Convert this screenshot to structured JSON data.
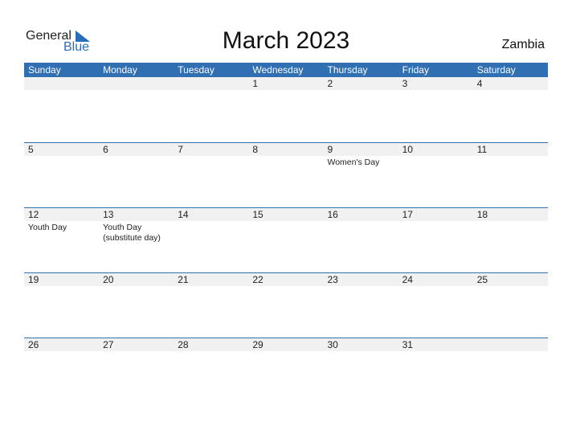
{
  "logo": {
    "general": "General",
    "blue": "Blue"
  },
  "title": "March 2023",
  "country": "Zambia",
  "colors": {
    "accent": "#2f6fb2",
    "row_bg": "#f1f1f1"
  },
  "weekdays": [
    "Sunday",
    "Monday",
    "Tuesday",
    "Wednesday",
    "Thursday",
    "Friday",
    "Saturday"
  ],
  "weeks": [
    {
      "days": [
        "",
        "",
        "",
        "1",
        "2",
        "3",
        "4"
      ],
      "events": [
        "",
        "",
        "",
        "",
        "",
        "",
        ""
      ]
    },
    {
      "days": [
        "5",
        "6",
        "7",
        "8",
        "9",
        "10",
        "11"
      ],
      "events": [
        "",
        "",
        "",
        "",
        "Women's Day",
        "",
        ""
      ]
    },
    {
      "days": [
        "12",
        "13",
        "14",
        "15",
        "16",
        "17",
        "18"
      ],
      "events": [
        "Youth Day",
        "Youth Day\n(substitute day)",
        "",
        "",
        "",
        "",
        ""
      ]
    },
    {
      "days": [
        "19",
        "20",
        "21",
        "22",
        "23",
        "24",
        "25"
      ],
      "events": [
        "",
        "",
        "",
        "",
        "",
        "",
        ""
      ]
    },
    {
      "days": [
        "26",
        "27",
        "28",
        "29",
        "30",
        "31",
        ""
      ],
      "events": [
        "",
        "",
        "",
        "",
        "",
        "",
        ""
      ]
    }
  ]
}
